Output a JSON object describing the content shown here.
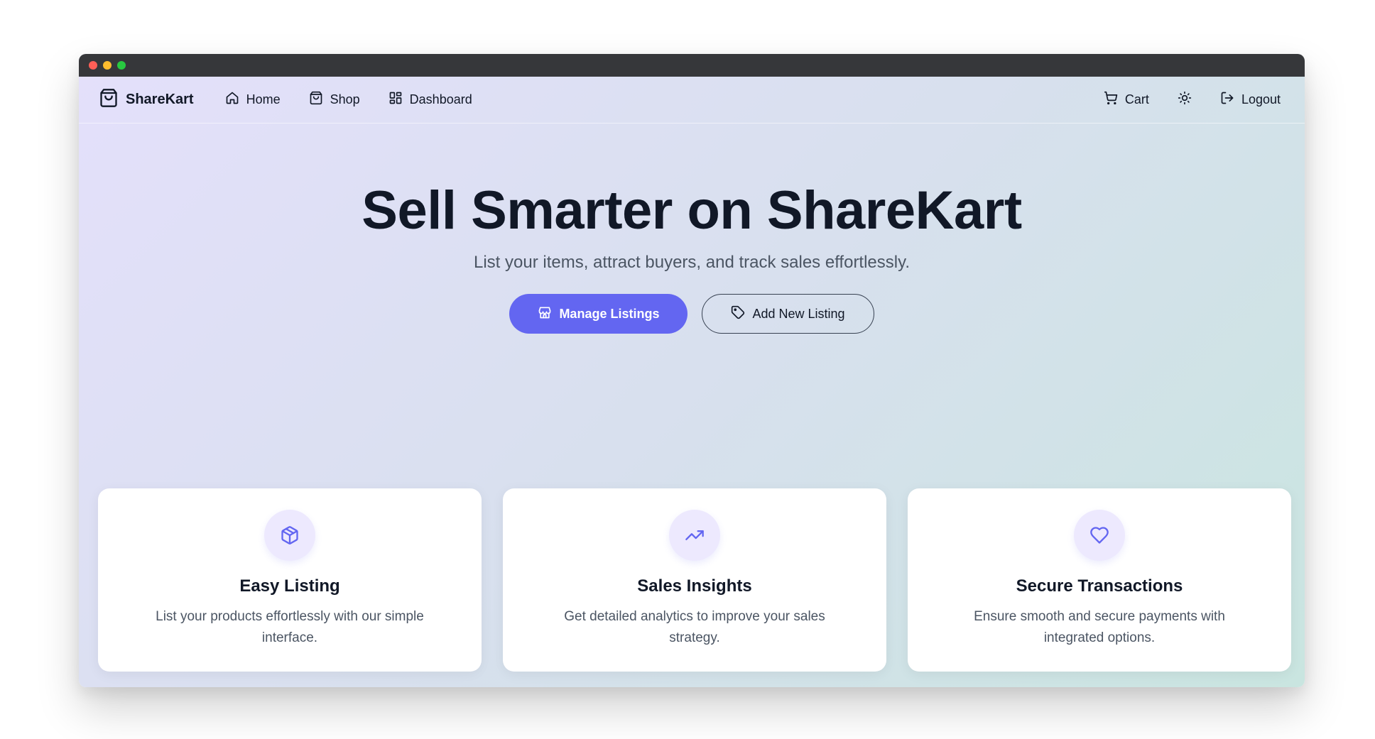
{
  "colors": {
    "accent": "#6366f1",
    "icon_circle": "#ede9fe",
    "heading": "#111827",
    "body_text": "#4b5563"
  },
  "window": {
    "controls": [
      "close",
      "minimize",
      "maximize"
    ]
  },
  "navbar": {
    "brand": {
      "label": "ShareKart",
      "icon": "shopping-bag-icon"
    },
    "links": [
      {
        "label": "Home",
        "icon": "home-icon"
      },
      {
        "label": "Shop",
        "icon": "shopping-bag-icon"
      },
      {
        "label": "Dashboard",
        "icon": "grid-icon"
      }
    ],
    "right": {
      "cart_label": "Cart",
      "cart_icon": "cart-icon",
      "theme_icon": "sun-icon",
      "logout_label": "Logout",
      "logout_icon": "logout-icon"
    }
  },
  "hero": {
    "title": "Sell Smarter on ShareKart",
    "subtitle": "List your items, attract buyers, and track sales effortlessly.",
    "primary_button": {
      "label": "Manage Listings",
      "icon": "store-icon"
    },
    "secondary_button": {
      "label": "Add New Listing",
      "icon": "tag-icon"
    }
  },
  "features": [
    {
      "title": "Easy Listing",
      "description": "List your products effortlessly with our simple interface.",
      "icon": "package-icon"
    },
    {
      "title": "Sales Insights",
      "description": "Get detailed analytics to improve your sales strategy.",
      "icon": "trending-up-icon"
    },
    {
      "title": "Secure Transactions",
      "description": "Ensure smooth and secure payments with integrated options.",
      "icon": "heart-icon"
    }
  ]
}
